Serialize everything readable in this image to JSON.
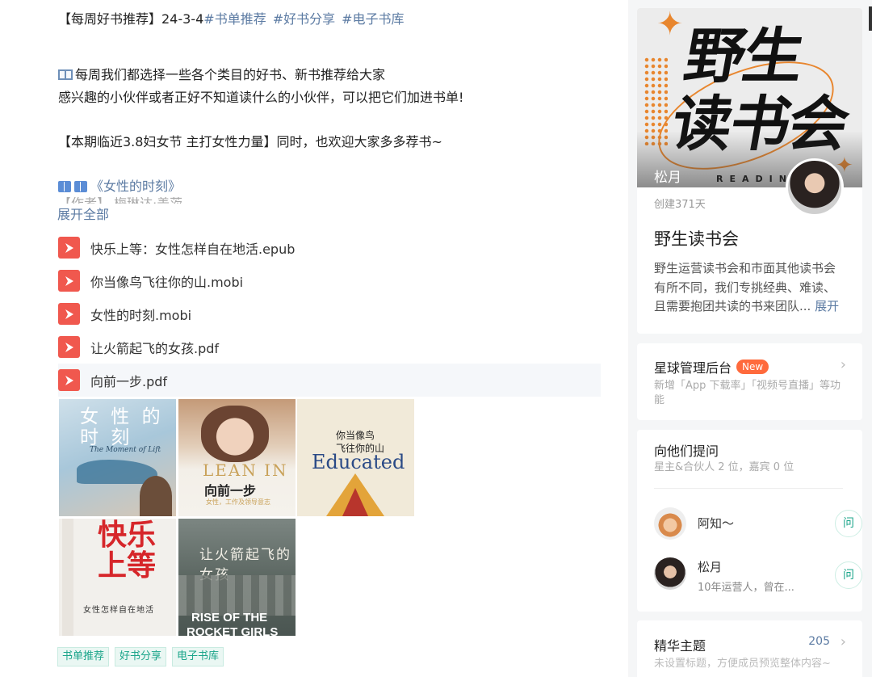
{
  "post": {
    "title_prefix": "【每周好书推荐】24-3-4",
    "title_tags": [
      "#书单推荐",
      "#好书分享",
      "#电子书库"
    ],
    "line2": "每周我们都选择一些各个类目的好书、新书推荐给大家",
    "line3": "感兴趣的小伙伴或者正好不知道读什么的小伙伴，可以把它们加进书单!",
    "line5": "【本期临近3.8妇女节 主打女性力量】同时，也欢迎大家多多荐书~",
    "book_line": "《女性的时刻》",
    "cut_line": "【作者】 梅琳达·盖茨",
    "expand_label": "展开全部",
    "files": [
      "快乐上等：女性怎样自在地活.epub",
      "你当像鸟飞往你的山.mobi",
      "女性的时刻.mobi",
      "让火箭起飞的女孩.pdf",
      "向前一步.pdf"
    ],
    "covers": {
      "c1_title": "女 性 的",
      "c1_title2": "时    刻",
      "c1_sub": "The Moment of Lift",
      "c2_en": "LEAN IN",
      "c2_cn": "向前一步",
      "c2_small": "女性，工作及领导意志",
      "c3_cn1": "你当像鸟",
      "c3_cn2": "飞往你的山",
      "c3_en": "Educated",
      "c4_cn1": "快乐",
      "c4_cn2": "上等",
      "c4_sub": "女性怎样自在地活",
      "c5_cn": "让火箭起飞的女孩",
      "c5_en1": "RISE OF THE",
      "c5_en2": "ROCKET GIRLS"
    },
    "bottom_tags": [
      "书单推荐",
      "好书分享",
      "电子书库"
    ]
  },
  "sidebar": {
    "banner_line1": "野生",
    "banner_line2": "读书会",
    "banner_reading": "READING",
    "owner": "松月",
    "created": "创建371天",
    "group_name": "野生读书会",
    "desc_1": "野生运营读书会和市面其他读书会",
    "desc_2": "有所不同，我们专挑经典、难读、",
    "desc_3": "且需要抱团共读的书来团队...",
    "desc_expand": "展开",
    "admin_title": "星球管理后台",
    "admin_badge": "New",
    "admin_sub": "新增「App 下载率」「视频号直播」等功能",
    "ask_title": "向他们提问",
    "ask_sub": "星主&合伙人 2 位，嘉宾 0 位",
    "people": [
      {
        "name": "阿知～",
        "sub": ""
      },
      {
        "name": "松月",
        "sub": "10年运营人，曾在..."
      }
    ],
    "ask_label": "问",
    "essence_title": "精华主题",
    "essence_count": "205",
    "essence_sub": "未设置标题，方便成员预览整体内容~"
  },
  "colors": {
    "link": "#5c7ba3",
    "tag": "#1ba58a",
    "badge": "#ff6a3c",
    "file_icon": "#f0584e"
  },
  "icons": {
    "file": "pdf-file-icon",
    "chevron": "chevron-right-icon"
  }
}
